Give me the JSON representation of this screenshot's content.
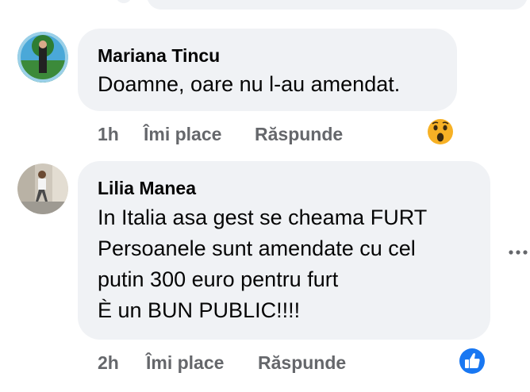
{
  "comments": [
    {
      "author": "Mariana Tincu",
      "lines": [
        "Doamne, oare nu l-au amendat."
      ],
      "time": "1h",
      "like_label": "Îmi place",
      "reply_label": "Răspunde",
      "reaction_icon": "wow-reaction-icon"
    },
    {
      "author": "Lilia Manea",
      "lines": [
        "In Italia asa gest se cheama FURT",
        "Persoanele sunt amendate cu cel",
        "putin 300 euro pentru furt",
        "È un BUN PUBLIC!!!!"
      ],
      "time": "2h",
      "like_label": "Îmi place",
      "reply_label": "Răspunde",
      "reaction_icon": "like-reaction-icon"
    }
  ],
  "colors": {
    "bubble": "#f0f2f5",
    "meta_text": "#65676b",
    "like_blue": "#1877f2",
    "wow_yellow": "#f7b125"
  }
}
